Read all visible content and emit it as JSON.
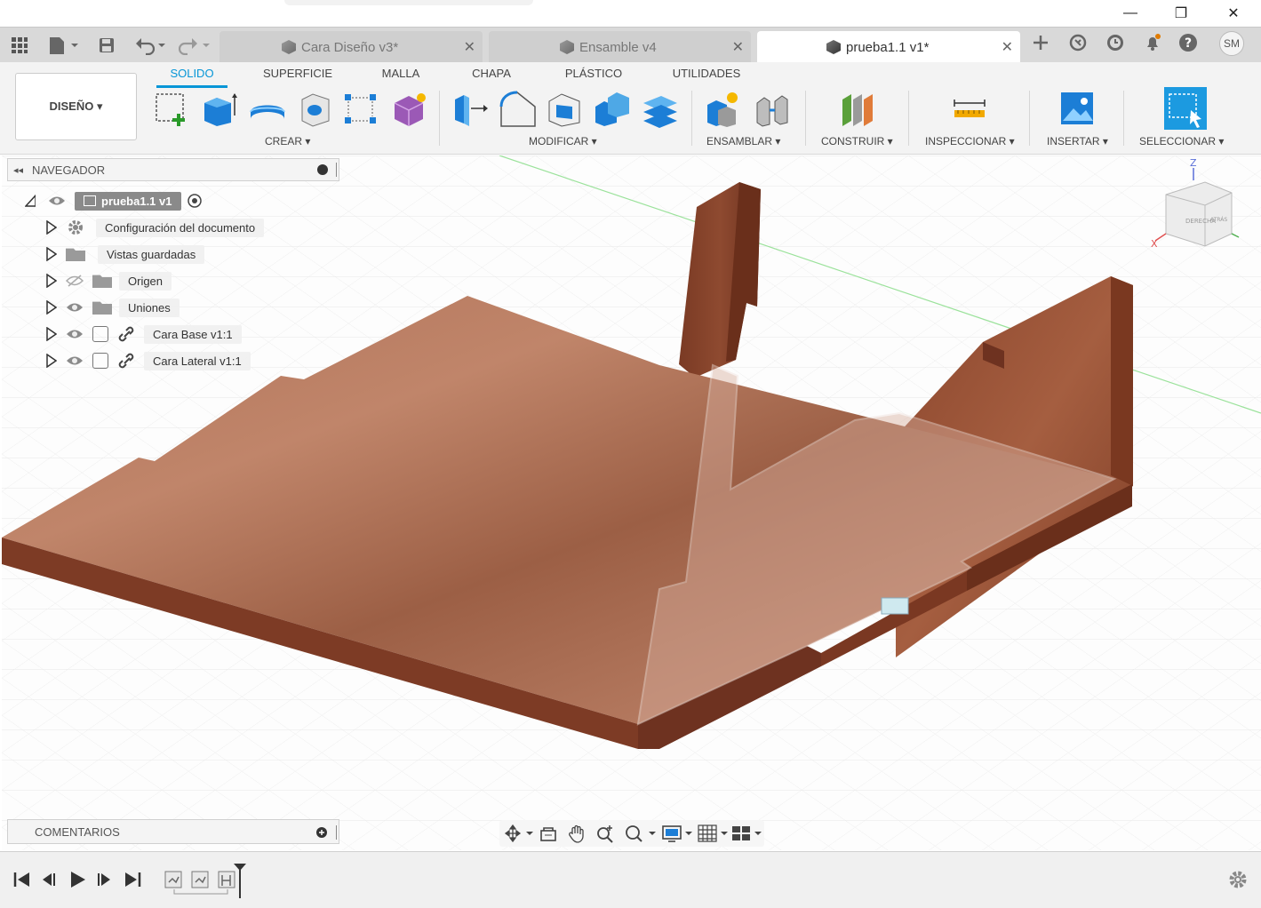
{
  "window": {
    "minimize": "—",
    "maximize": "❐",
    "close": "✕"
  },
  "tabs": [
    {
      "label": "Cara Diseño v3*",
      "close": "✕"
    },
    {
      "label": "Ensamble v4",
      "close": "✕"
    },
    {
      "label": "prueba1.1 v1*",
      "close": "✕"
    }
  ],
  "user": {
    "initials": "SM"
  },
  "workspace": {
    "label": "DISEÑO ▾"
  },
  "ribbon_tabs": [
    "SOLIDO",
    "SUPERFICIE",
    "MALLA",
    "CHAPA",
    "PLÁSTICO",
    "UTILIDADES"
  ],
  "ribbon_groups": {
    "crear": "CREAR ▾",
    "modificar": "MODIFICAR ▾",
    "ensamblar": "ENSAMBLAR ▾",
    "construir": "CONSTRUIR ▾",
    "inspeccionar": "INSPECCIONAR ▾",
    "insertar": "INSERTAR ▾",
    "seleccionar": "SELECCIONAR ▾"
  },
  "navigator": {
    "title": "NAVEGADOR",
    "root": "prueba1.1 v1",
    "items": [
      "Configuración del documento",
      "Vistas guardadas",
      "Origen",
      "Uniones",
      "Cara Base v1:1",
      "Cara Lateral v1:1"
    ]
  },
  "viewcube": {
    "z": "Z",
    "x": "X",
    "face_front": "DERECHA",
    "face_side": "ATRÁS"
  },
  "comments": {
    "title": "COMENTARIOS"
  },
  "colors": {
    "accent": "#0696d7",
    "wood": "#9a5a3c"
  }
}
